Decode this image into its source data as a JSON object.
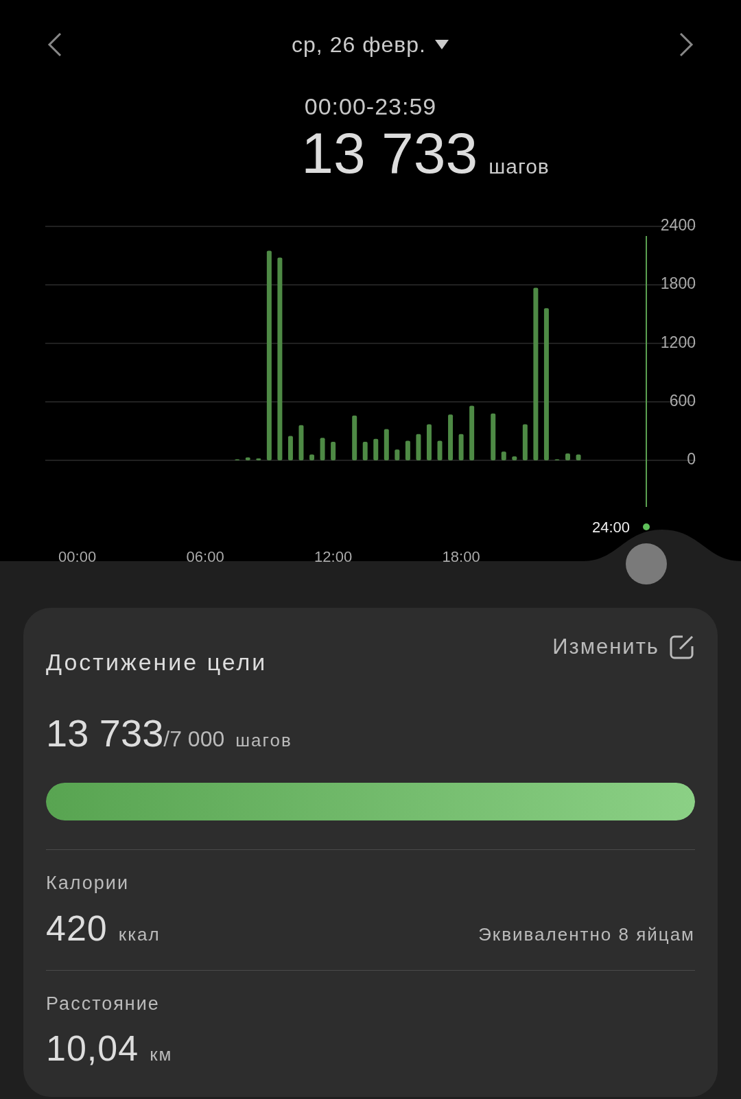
{
  "header": {
    "date": "ср, 26 февр.",
    "time_range": "00:00-23:59",
    "total_steps": "13 733",
    "steps_unit": "шагов"
  },
  "chart": {
    "chart_data": {
      "type": "bar",
      "x": [
        7.5,
        8,
        8.5,
        9,
        9.5,
        10,
        10.5,
        11,
        11.5,
        12,
        13,
        13.5,
        14,
        14.5,
        15,
        15.5,
        16,
        16.5,
        17,
        17.5,
        18,
        18.5,
        19.5,
        20,
        20.5,
        21,
        21.5,
        22,
        22.5,
        23,
        23.5
      ],
      "values": [
        10,
        30,
        20,
        2150,
        2080,
        250,
        360,
        60,
        230,
        190,
        460,
        190,
        220,
        320,
        110,
        200,
        270,
        370,
        200,
        470,
        270,
        560,
        480,
        90,
        40,
        370,
        1770,
        1560,
        10,
        70,
        60
      ],
      "grid": true,
      "xlim": [
        -1.5,
        29
      ],
      "ylim": [
        0,
        2400
      ],
      "yticks": [
        {
          "value": 0,
          "label": "0"
        },
        {
          "value": 600,
          "label": "600"
        },
        {
          "value": 1200,
          "label": "1200"
        },
        {
          "value": 1800,
          "label": "1800"
        },
        {
          "value": 2400,
          "label": "2400"
        }
      ],
      "xticks": [
        {
          "value": 0,
          "label": "00:00"
        },
        {
          "value": 6,
          "label": "06:00"
        },
        {
          "value": 12,
          "label": "12:00"
        },
        {
          "value": 18,
          "label": "18:00"
        }
      ]
    },
    "scrubber_label": "24:00"
  },
  "goal": {
    "title": "Достижение цели",
    "edit_label": "Изменить",
    "current": "13 733",
    "target": "/7 000",
    "unit": "шагов",
    "level": 1
  },
  "stats": [
    {
      "label": "Калории",
      "value": "420",
      "unit": "ккал",
      "note": "Эквивалентно 8 яйцам"
    },
    {
      "label": "Расстояние",
      "value": "10,04",
      "unit": "км"
    }
  ]
}
